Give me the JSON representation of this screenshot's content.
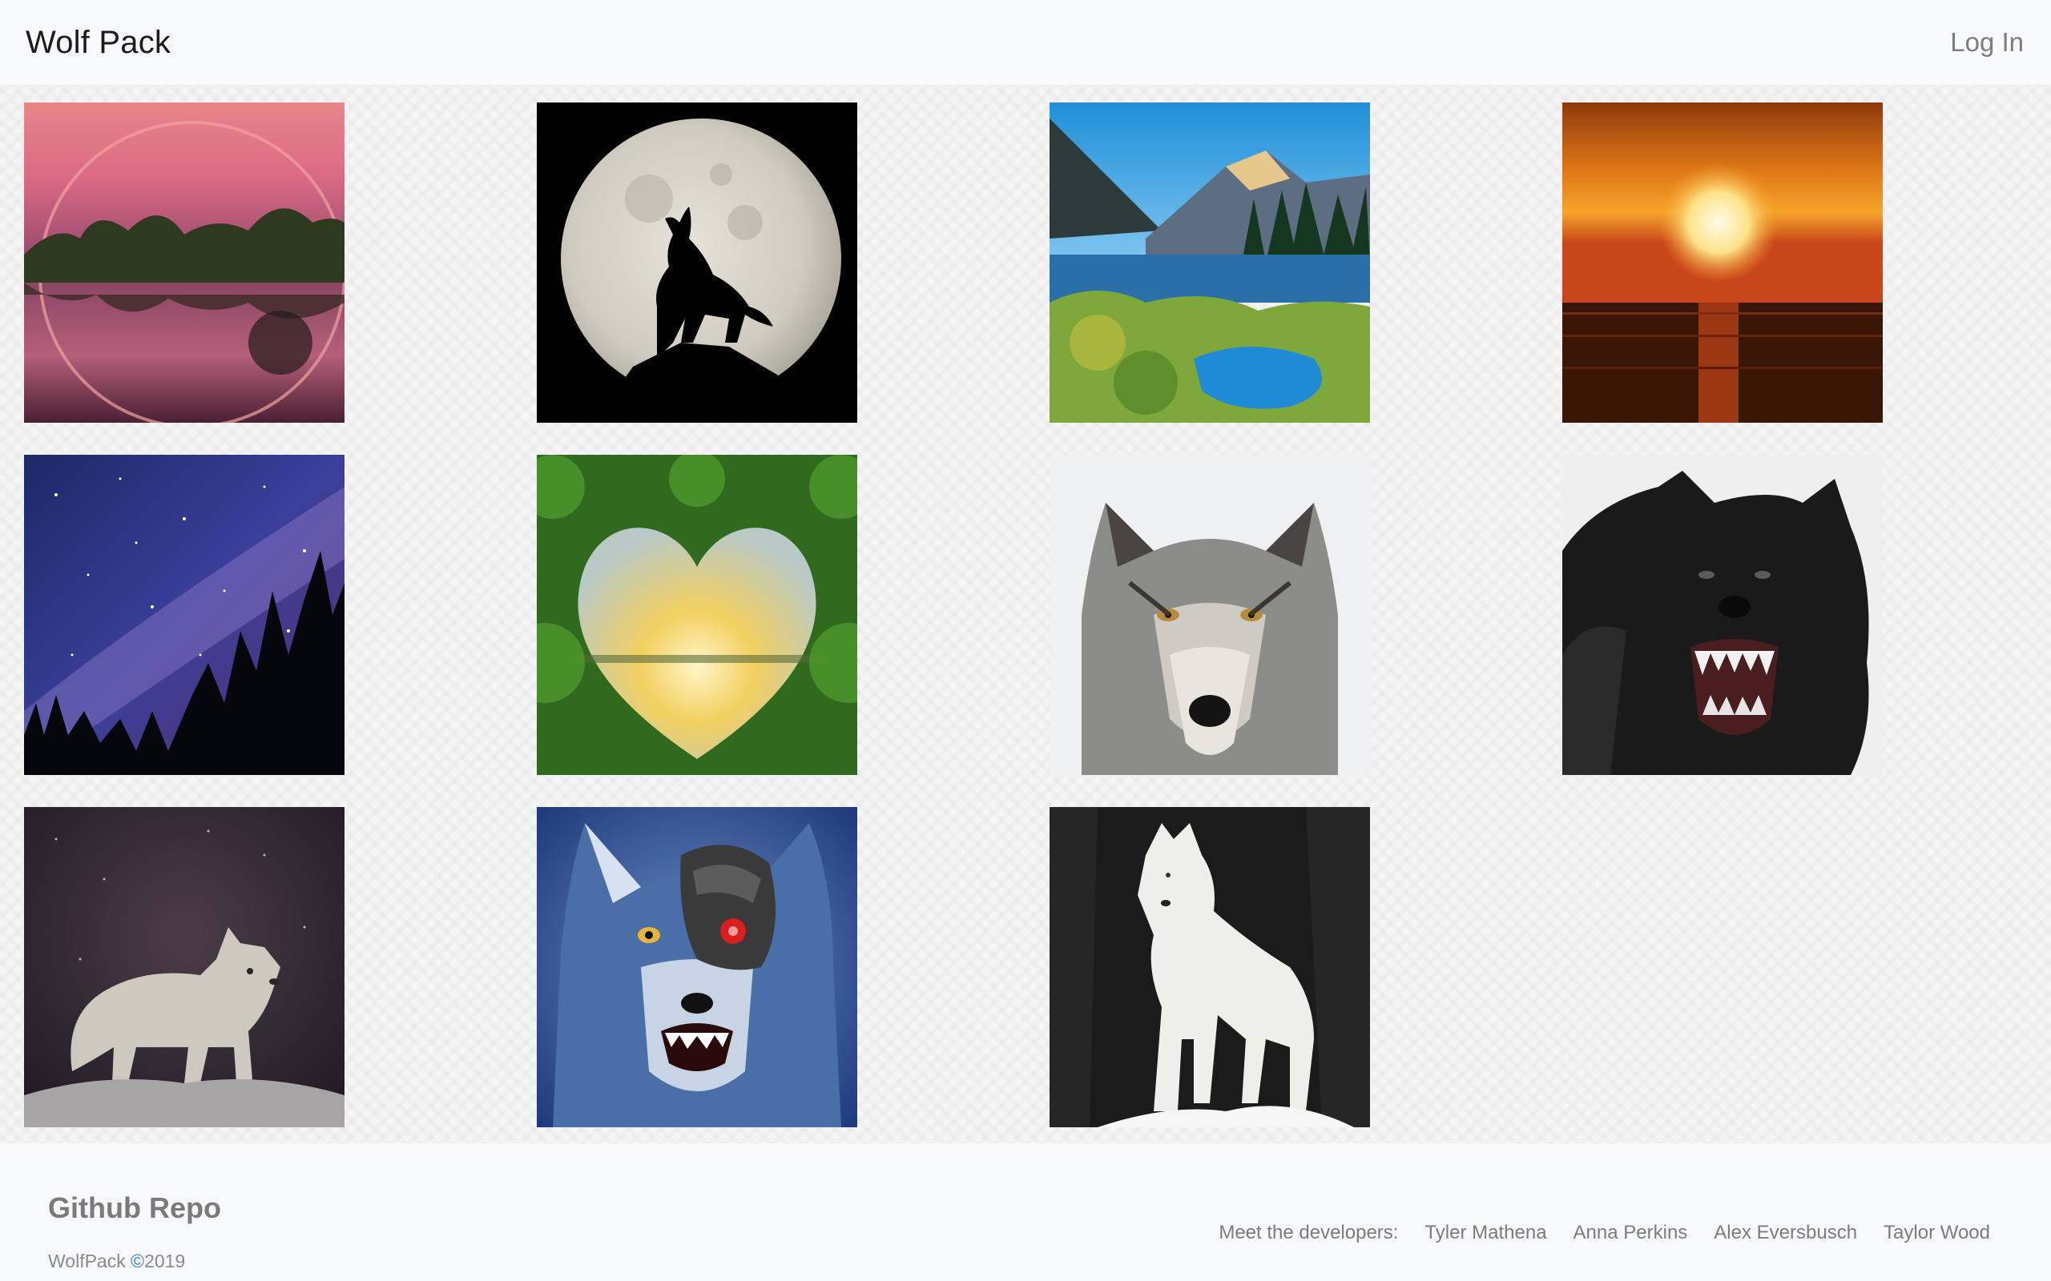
{
  "navbar": {
    "brand": "Wolf Pack",
    "login": "Log In"
  },
  "gallery": {
    "images": [
      {
        "subject": "pink rainbow sunset over lake with trees"
      },
      {
        "subject": "wolf silhouette howling at full moon"
      },
      {
        "subject": "mountain lake with evergreen forest"
      },
      {
        "subject": "orange sunset over ocean"
      },
      {
        "subject": "milky way night sky over pine trees"
      },
      {
        "subject": "heart-shaped forest opening at sunset"
      },
      {
        "subject": "gray wolf face portrait"
      },
      {
        "subject": "snarling black wolf"
      },
      {
        "subject": "white wolf pup on rock"
      },
      {
        "subject": "blue wolf with robotic eye piece"
      },
      {
        "subject": "white wolf standing in snow"
      }
    ]
  },
  "footer": {
    "repo": "Github Repo",
    "brand": "WolfPack",
    "copy_symbol": "©",
    "year": "2019",
    "developers_label": "Meet the developers:",
    "developers": [
      "Tyler Mathena",
      "Anna Perkins",
      "Alex Eversbusch",
      "Taylor Wood"
    ]
  }
}
